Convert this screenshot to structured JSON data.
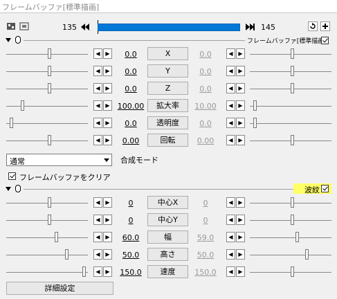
{
  "window": {
    "title": "フレームバッファ[標準描画]"
  },
  "timeline": {
    "start_frame": "135",
    "end_frame": "145"
  },
  "section1": {
    "name": "フレームバッファ[標準描画]",
    "rows": [
      {
        "label": "X",
        "left": "0.0",
        "right": "0.0"
      },
      {
        "label": "Y",
        "left": "0.0",
        "right": "0.0"
      },
      {
        "label": "Z",
        "left": "0.0",
        "right": "0.0"
      },
      {
        "label": "拡大率",
        "left": "100.00",
        "right": "10.00"
      },
      {
        "label": "透明度",
        "left": "0.0",
        "right": "0.0"
      },
      {
        "label": "回転",
        "left": "0.00",
        "right": "0.00"
      }
    ],
    "blend": {
      "value": "通常",
      "label": "合成モード"
    },
    "clear_label": "フレームバッファをクリア"
  },
  "section2": {
    "name": "波紋",
    "rows": [
      {
        "label": "中心X",
        "left": "0",
        "right": "0"
      },
      {
        "label": "中心Y",
        "left": "0",
        "right": "0"
      },
      {
        "label": "幅",
        "left": "60.0",
        "right": "59.0"
      },
      {
        "label": "高さ",
        "left": "50.0",
        "right": "50.0"
      },
      {
        "label": "速度",
        "left": "150.0",
        "right": "150.0"
      }
    ],
    "highlight_color": "#ffff66"
  },
  "detail_button": "詳細設定",
  "colors": {
    "frame_bar": "#0078d7",
    "background": "#f0f0f0"
  }
}
